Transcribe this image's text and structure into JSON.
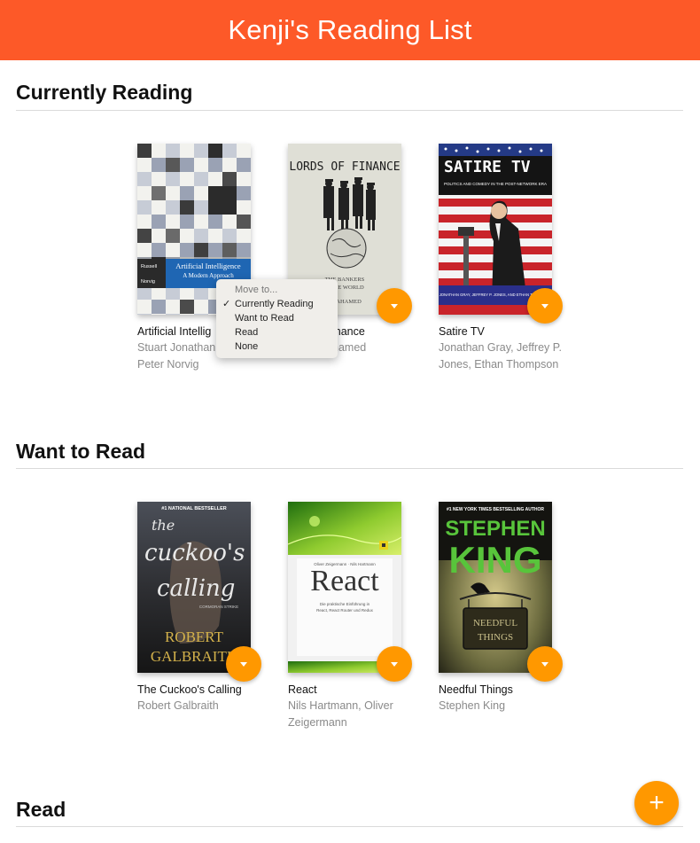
{
  "app": {
    "title": "Kenji's Reading List"
  },
  "shelves": [
    {
      "title": "Currently Reading",
      "books": [
        {
          "title": "Artificial Intelligence: A Modern Approach",
          "title_display": "Artificial Intellig",
          "authors_display": [
            "Stuart Jonathan",
            "Peter Norvig"
          ],
          "cover": {
            "title_line1": "Artificial Intelligence",
            "title_line2": "A Modern Approach",
            "author_lines": [
              "Russell",
              "Norvig"
            ]
          }
        },
        {
          "title": "Lords of Finance",
          "title_display": "inance",
          "authors_display": [
            "hamed"
          ],
          "cover": {
            "title": "LORDS OF FINANCE",
            "subtitle_line1": "THE BANKERS",
            "subtitle_line2": "E THE WORLD",
            "author": "AT AHAMED"
          }
        },
        {
          "title": "Satire TV",
          "authors_display": [
            "Jonathan Gray, Jeffrey P.",
            "Jones, Ethan Thompson"
          ],
          "cover": {
            "title": "SATIRE TV",
            "tagline": "POLITICS AND COMEDY IN THE POST-NETWORK ERA",
            "credits": "JONATHAN GRAY, JEFFREY P. JONES, AND ETHAN THOMPSON"
          }
        }
      ]
    },
    {
      "title": "Want to Read",
      "books": [
        {
          "title": "The Cuckoo's Calling",
          "authors_display": [
            "Robert Galbraith"
          ],
          "cover": {
            "badge": "#1 NATIONAL BESTSELLER",
            "title_line1": "the",
            "title_line2": "cuckoo's",
            "title_line3": "calling",
            "series": "CORMORAN STRIKE",
            "author_line1": "ROBERT",
            "author_line2": "GALBRAITH"
          }
        },
        {
          "title": "React",
          "authors_display": [
            "Nils Hartmann, Oliver",
            "Zeigermann"
          ],
          "cover": {
            "authors": "Oliver Zeigermann · Nils Hartmann",
            "title": "React",
            "subtitle_line1": "Die praktische Einführung in",
            "subtitle_line2": "React, React Router und Redux"
          }
        },
        {
          "title": "Needful Things",
          "authors_display": [
            "Stephen King"
          ],
          "cover": {
            "badge": "#1 NEW YORK TIMES BESTSELLING AUTHOR",
            "author_line1": "STEPHEN",
            "author_line2": "KING",
            "title_line1": "NEEDFUL",
            "title_line2": "THINGS"
          }
        }
      ]
    },
    {
      "title": "Read"
    }
  ],
  "shelf_menu": {
    "header": "Move to...",
    "options": [
      "Currently Reading",
      "Want to Read",
      "Read",
      "None"
    ],
    "selected": "Currently Reading",
    "check": "✓"
  },
  "add_button": {
    "label": "+"
  },
  "colors": {
    "header": "#fd5928",
    "accent": "#ff9800"
  }
}
